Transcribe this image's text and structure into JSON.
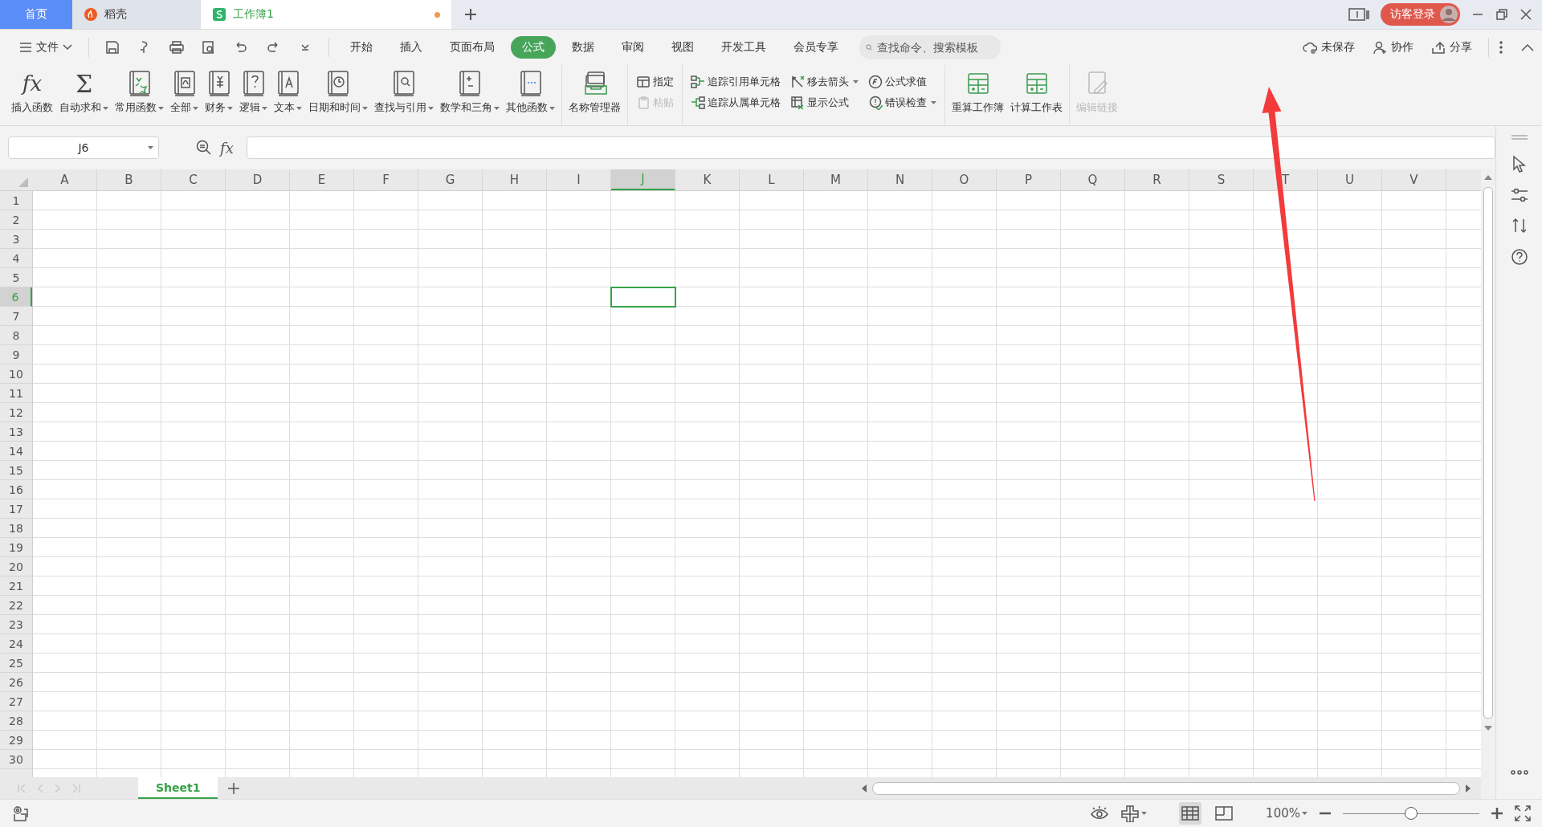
{
  "tabs": [
    {
      "kind": "home",
      "label": "首页",
      "selected": false,
      "modified": false
    },
    {
      "kind": "docer",
      "label": "稻壳",
      "selected": false,
      "modified": false
    },
    {
      "kind": "sheet",
      "label": "工作簿1",
      "selected": true,
      "modified": true
    }
  ],
  "login": {
    "label": "访客登录"
  },
  "menu": {
    "file": "文件",
    "ribbon_tabs": [
      {
        "label": "开始",
        "selected": false
      },
      {
        "label": "插入",
        "selected": false
      },
      {
        "label": "页面布局",
        "selected": false
      },
      {
        "label": "公式",
        "selected": true
      },
      {
        "label": "数据",
        "selected": false
      },
      {
        "label": "审阅",
        "selected": false
      },
      {
        "label": "视图",
        "selected": false
      },
      {
        "label": "开发工具",
        "selected": false
      },
      {
        "label": "会员专享",
        "selected": false
      }
    ],
    "search": {
      "placeholder": "查找命令、搜索模板"
    },
    "actions": [
      "未保存",
      "协作",
      "分享"
    ]
  },
  "ribbon": {
    "groups": [
      {
        "kind": "large",
        "items": [
          {
            "label": "插入函数",
            "symbol": "fx",
            "dropdown": false,
            "disabled": false
          },
          {
            "label": "自动求和",
            "symbol": "Σ",
            "dropdown": true,
            "disabled": false
          },
          {
            "label": "常用函数",
            "dropdown": true,
            "disabled": false
          },
          {
            "label": "全部",
            "dropdown": true,
            "disabled": false
          },
          {
            "label": "财务",
            "dropdown": true,
            "disabled": false
          },
          {
            "label": "逻辑",
            "dropdown": true,
            "disabled": false
          },
          {
            "label": "文本",
            "dropdown": true,
            "disabled": false
          },
          {
            "label": "日期和时间",
            "dropdown": true,
            "disabled": false
          },
          {
            "label": "查找与引用",
            "dropdown": true,
            "disabled": false
          },
          {
            "label": "数学和三角",
            "dropdown": true,
            "disabled": false
          },
          {
            "label": "其他函数",
            "dropdown": true,
            "disabled": false
          }
        ]
      },
      {
        "kind": "large",
        "items": [
          {
            "label": "名称管理器",
            "dropdown": false,
            "disabled": false
          }
        ]
      },
      {
        "kind": "small",
        "items": [
          {
            "label": "指定",
            "dropdown": false,
            "disabled": false
          },
          {
            "label": "粘贴",
            "dropdown": false,
            "disabled": true
          }
        ]
      },
      {
        "kind": "small",
        "items": [
          {
            "label": "追踪引用单元格",
            "dropdown": false,
            "disabled": false
          },
          {
            "label": "追踪从属单元格",
            "dropdown": false,
            "disabled": false
          },
          {
            "label": "移去箭头",
            "dropdown": true,
            "disabled": false
          },
          {
            "label": "显示公式",
            "dropdown": false,
            "disabled": false
          },
          {
            "label": "公式求值",
            "dropdown": false,
            "disabled": false
          },
          {
            "label": "错误检查",
            "dropdown": true,
            "disabled": false
          }
        ]
      },
      {
        "kind": "large",
        "items": [
          {
            "label": "重算工作簿",
            "dropdown": false,
            "disabled": false
          },
          {
            "label": "计算工作表",
            "dropdown": false,
            "disabled": false
          }
        ]
      },
      {
        "kind": "large",
        "items": [
          {
            "label": "编辑链接",
            "dropdown": false,
            "disabled": true
          }
        ]
      }
    ]
  },
  "formula_bar": {
    "name_box": "J6",
    "fx": "fx"
  },
  "columns": [
    {
      "label": "A",
      "selected": false
    },
    {
      "label": "B",
      "selected": false
    },
    {
      "label": "C",
      "selected": false
    },
    {
      "label": "D",
      "selected": false
    },
    {
      "label": "E",
      "selected": false
    },
    {
      "label": "F",
      "selected": false
    },
    {
      "label": "G",
      "selected": false
    },
    {
      "label": "H",
      "selected": false
    },
    {
      "label": "I",
      "selected": false
    },
    {
      "label": "J",
      "selected": true
    },
    {
      "label": "K",
      "selected": false
    },
    {
      "label": "L",
      "selected": false
    },
    {
      "label": "M",
      "selected": false
    },
    {
      "label": "N",
      "selected": false
    },
    {
      "label": "O",
      "selected": false
    },
    {
      "label": "P",
      "selected": false
    },
    {
      "label": "Q",
      "selected": false
    },
    {
      "label": "R",
      "selected": false
    },
    {
      "label": "S",
      "selected": false
    },
    {
      "label": "T",
      "selected": false
    },
    {
      "label": "U",
      "selected": false
    },
    {
      "label": "V",
      "selected": false
    }
  ],
  "rows": [
    {
      "label": "1",
      "selected": false
    },
    {
      "label": "2",
      "selected": false
    },
    {
      "label": "3",
      "selected": false
    },
    {
      "label": "4",
      "selected": false
    },
    {
      "label": "5",
      "selected": false
    },
    {
      "label": "6",
      "selected": true
    },
    {
      "label": "7",
      "selected": false
    },
    {
      "label": "8",
      "selected": false
    },
    {
      "label": "9",
      "selected": false
    },
    {
      "label": "10",
      "selected": false
    },
    {
      "label": "11",
      "selected": false
    },
    {
      "label": "12",
      "selected": false
    },
    {
      "label": "13",
      "selected": false
    },
    {
      "label": "14",
      "selected": false
    },
    {
      "label": "15",
      "selected": false
    },
    {
      "label": "16",
      "selected": false
    },
    {
      "label": "17",
      "selected": false
    },
    {
      "label": "18",
      "selected": false
    },
    {
      "label": "19",
      "selected": false
    },
    {
      "label": "20",
      "selected": false
    },
    {
      "label": "21",
      "selected": false
    },
    {
      "label": "22",
      "selected": false
    },
    {
      "label": "23",
      "selected": false
    },
    {
      "label": "24",
      "selected": false
    },
    {
      "label": "25",
      "selected": false
    },
    {
      "label": "26",
      "selected": false
    },
    {
      "label": "27",
      "selected": false
    },
    {
      "label": "28",
      "selected": false
    },
    {
      "label": "29",
      "selected": false
    },
    {
      "label": "30",
      "selected": false
    }
  ],
  "sheet_tabs": [
    {
      "label": "Sheet1",
      "selected": true
    }
  ],
  "status_bar": {
    "zoom": "100%",
    "zoom_slider": {
      "level": 0.5
    }
  }
}
